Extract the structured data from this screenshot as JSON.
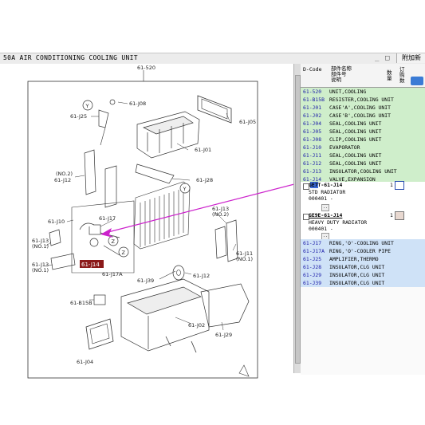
{
  "window": {
    "title": "50A  AIR CONDITIONING COOLING UNIT",
    "minimize": "_",
    "restore": "□",
    "add_button": "附加新"
  },
  "header": {
    "code_col": "D-Code",
    "name_col_line1": "部件名称",
    "name_col_line2": "部件号",
    "name_col_line3": "说明",
    "qty_col": "数量",
    "order_col": "订购数"
  },
  "parts_top": [
    {
      "code": "61-520",
      "desc": "UNIT,COOLING"
    },
    {
      "code": "61-B15B",
      "desc": "RESISTER,COOLING UNIT"
    },
    {
      "code": "61-J01",
      "desc": "CASE'A',COOLING UNIT"
    },
    {
      "code": "61-J02",
      "desc": "CASE'B',COOLING UNIT"
    },
    {
      "code": "61-J04",
      "desc": "SEAL,COOLING UNIT"
    },
    {
      "code": "61-J05",
      "desc": "SEAL,COOLING UNIT"
    },
    {
      "code": "61-J08",
      "desc": "CLIP,COOLING UNIT"
    },
    {
      "code": "61-J10",
      "desc": "EVAPORATOR"
    },
    {
      "code": "61-J11",
      "desc": "SEAL,COOLING UNIT"
    },
    {
      "code": "61-J12",
      "desc": "SEAL,COOLING UNIT"
    },
    {
      "code": "61-J13",
      "desc": "INSULATOR,COOLING UNIT"
    },
    {
      "code": "61-J14",
      "desc": "VALVE,EXPANSION"
    }
  ],
  "expanded": [
    {
      "part": "GE7T-61-J14",
      "qty": "1",
      "line2": "STD RADIATOR",
      "line3": "000401  -"
    },
    {
      "part": "GE9E-61-J14",
      "qty": "1",
      "line2": "HEAVY DUTY RADIATOR",
      "line3": "000401  -"
    }
  ],
  "expand_icon": "..",
  "parts_bottom": [
    {
      "code": "61-J17",
      "desc": "RING,'O'-COOLING UNIT"
    },
    {
      "code": "61-J17A",
      "desc": "RING,'O'-COOLER PIPE"
    },
    {
      "code": "61-J25",
      "desc": "AMPLIFIER,THERMO"
    },
    {
      "code": "61-J28",
      "desc": "INSULATOR,CLG UNIT"
    },
    {
      "code": "61-J29",
      "desc": "INSULATOR,CLG UNIT"
    },
    {
      "code": "61-J39",
      "desc": "INSULATOR,CLG UNIT"
    }
  ],
  "diagram": {
    "callouts": {
      "c520": "61-520",
      "cJ08": "61-J08",
      "cJ25": "61-J25",
      "cJ05": "61-J05",
      "cJ01": "61-J01",
      "cNO2a": "(NO.2)",
      "cJ12a": "61-J12",
      "cJ28": "61-J28",
      "cJ10": "61-J10",
      "cJ17": "61-J17",
      "cJ13a": "61-J13",
      "cNO2b": "(NO.2)",
      "cJ13b": "61-J13",
      "cNO1a": "(NO.1)",
      "cJ13c": "61-J13",
      "cNO1b": "(NO.1)",
      "cJ11": "61-J11",
      "cNO1c": "(NO.1)",
      "cJ17A": "61-J17A",
      "cJ39": "61-J39",
      "cJ12b": "61-J12",
      "cB15B": "61-B15B",
      "cJ02": "61-J02",
      "cJ29": "61-J29",
      "cJ04": "61-J04",
      "cJ14": "61-J14",
      "markY1": "Y",
      "markY2": "Y",
      "markZ1": "Z",
      "markZ2": "Z"
    }
  },
  "colors": {
    "highlight_accent": "#cc22cc",
    "callout_red": "#8b1a1a",
    "green_row": "#cfeecb",
    "blue_row": "#cfe2f7"
  }
}
